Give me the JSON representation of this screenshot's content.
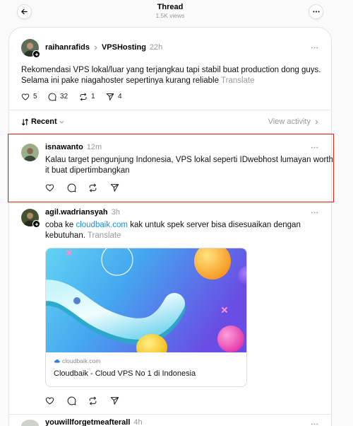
{
  "header": {
    "title": "Thread",
    "views": "1.5K views"
  },
  "post": {
    "author": "raihanrafids",
    "community": "VPSHosting",
    "time": "22h",
    "text": "Rekomendasi VPS lokal/luar yang terjangkau tapi stabil buat production dong guys. Selama ini pake niagahoster sepertinya kurang reliable",
    "translate": "Translate",
    "stats": {
      "likes": 5,
      "replies": 32,
      "reposts": 1,
      "shares": 4
    }
  },
  "sort": {
    "label": "Recent",
    "activity": "View activity"
  },
  "replies": [
    {
      "author": "isnawanto",
      "time": "12m",
      "text": "Kalau target pengunjung Indonesia, VPS lokal seperti IDwebhost lumayan worth it buat dipertimbangkan"
    },
    {
      "author": "agil.wadriansyah",
      "time": "3h",
      "text_before": "coba ke ",
      "link": "cloudbaik.com",
      "text_after": " kak untuk spek server bisa disesuaikan dengan kebutuhan.",
      "translate": "Translate",
      "preview": {
        "domain": "cloudbaik.com",
        "title": "Cloudbaik - Cloud VPS No 1 di Indonesia"
      }
    },
    {
      "author": "youwillforgetmeafterall",
      "time": "4h"
    }
  ],
  "icons": {
    "back": "arrow-left-icon",
    "menu": "more-horizontal-icon",
    "follow_badge": "plus-icon",
    "community_separator": "chevron-right-icon",
    "like": "heart-icon",
    "reply": "comment-icon",
    "repost": "repost-icon",
    "share": "send-icon",
    "sort": "sort-icon",
    "sort_dropdown": "chevron-down-icon",
    "activity": "chevron-right-icon",
    "preview_site": "cloud-icon"
  },
  "colors": {
    "background": "#fafafa",
    "card": "#ffffff",
    "text": "#000000",
    "muted": "#999999",
    "link": "#1a8fe3",
    "highlight": "#e0241e",
    "divider": "#e6e6e6"
  }
}
